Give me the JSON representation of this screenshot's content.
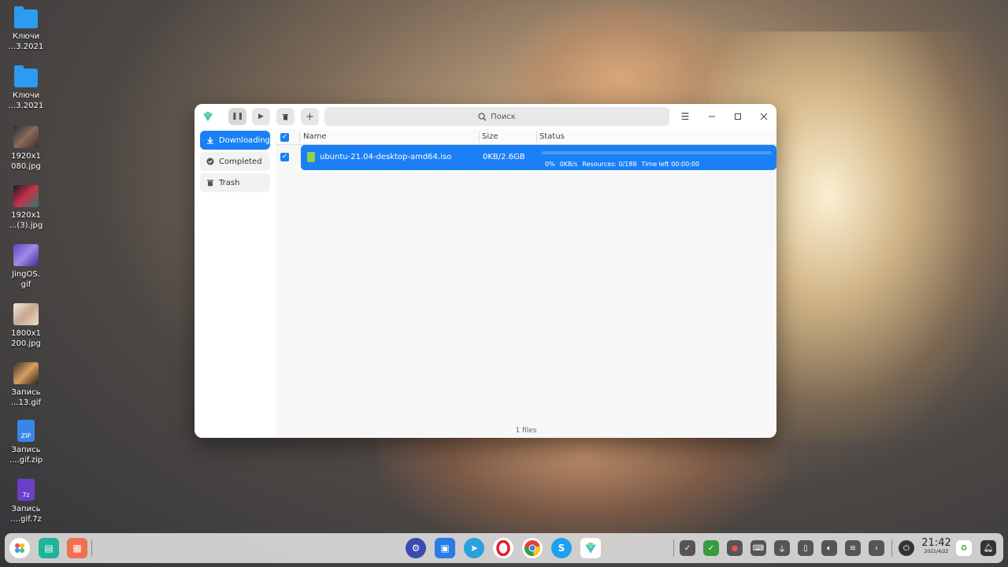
{
  "desktop": {
    "icons": [
      {
        "label": "Ключи\n...3.2021",
        "kind": "folder"
      },
      {
        "label": "Ключи\n...3.2021",
        "kind": "folder"
      },
      {
        "label": "1920x1\n080.jpg",
        "kind": "image"
      },
      {
        "label": "1920x1\n...(3).jpg",
        "kind": "image"
      },
      {
        "label": "JingOS.\ngif",
        "kind": "image"
      },
      {
        "label": "1800x1\n200.jpg",
        "kind": "image"
      },
      {
        "label": "Запись\n...13.gif",
        "kind": "image"
      },
      {
        "label": "Запись\n....gif.zip",
        "kind": "zip"
      },
      {
        "label": "Запись\n....gif.7z",
        "kind": "7z"
      }
    ]
  },
  "window": {
    "toolbar": {
      "pause_icon": "pause-icon",
      "start_icon": "play-icon",
      "delete_icon": "trash-icon",
      "add_icon": "plus-icon"
    },
    "search": {
      "placeholder": "Поиск"
    },
    "sidebar": {
      "items": [
        {
          "label": "Downloading",
          "icon": "download-icon",
          "active": true
        },
        {
          "label": "Completed",
          "icon": "check-circle-icon",
          "active": false
        },
        {
          "label": "Trash",
          "icon": "trash-icon",
          "active": false
        }
      ]
    },
    "table": {
      "columns": {
        "name": "Name",
        "size": "Size",
        "status": "Status"
      },
      "rows": [
        {
          "name": "ubuntu-21.04-desktop-amd64.iso",
          "size": "0KB/2.6GB",
          "progress_pct": 0,
          "status": {
            "percent": "0%",
            "speed": "0KB/s",
            "resources": "Resources: 0/188",
            "time_left": "Time left 00:00:00"
          }
        }
      ]
    },
    "footer": "1 files"
  },
  "taskbar": {
    "clock": {
      "time": "21:42",
      "date": "2021/4/22"
    }
  },
  "colors": {
    "accent": "#1b80f5"
  }
}
